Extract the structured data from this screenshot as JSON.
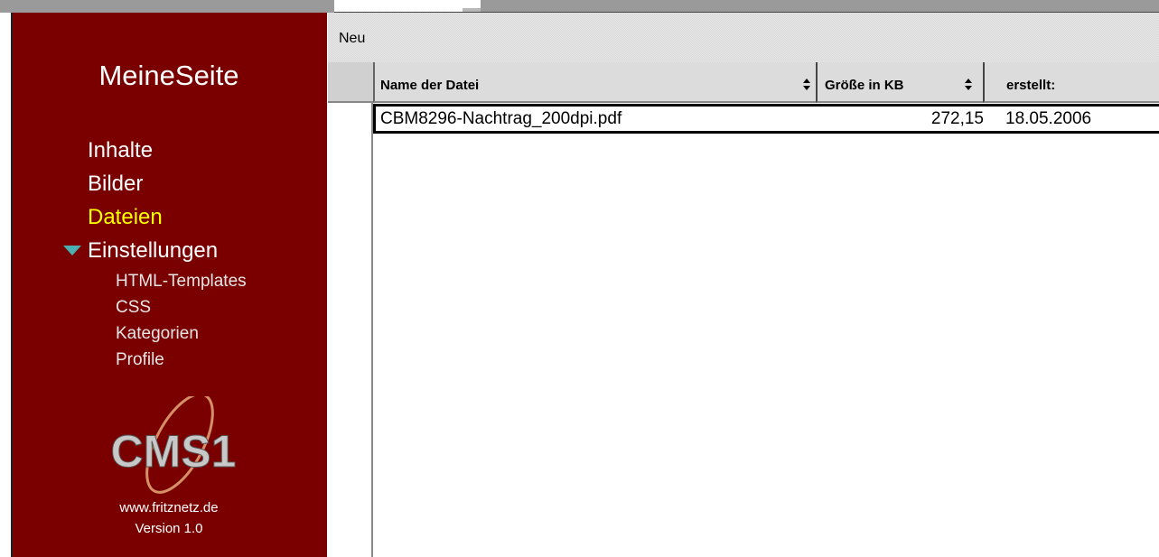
{
  "sidebar": {
    "title": "MeineSeite",
    "nav": [
      {
        "label": "Inhalte"
      },
      {
        "label": "Bilder"
      },
      {
        "label": "Dateien",
        "active": true
      },
      {
        "label": "Einstellungen",
        "expanded": true
      }
    ],
    "subnav": [
      {
        "label": "HTML-Templates"
      },
      {
        "label": "CSS"
      },
      {
        "label": "Kategorien"
      },
      {
        "label": "Profile"
      }
    ],
    "logo_text": "CMS1",
    "url": "www.fritznetz.de",
    "version": "Version 1.0"
  },
  "toolbar": {
    "new_label": "Neu"
  },
  "table": {
    "columns": [
      "Name der Datei",
      "Größe in KB",
      "erstellt:"
    ],
    "rows": [
      {
        "name": "CBM8296-Nachtrag_200dpi.pdf",
        "size": "272,15",
        "date": "18.05.2006"
      }
    ]
  },
  "colors": {
    "sidebar_bg": "#7a0000",
    "active_nav": "#ffff00",
    "expand_icon": "#4ab0b0"
  },
  "icons": [
    "expand-triangle-icon",
    "sort-icon",
    "cms1-logo"
  ]
}
